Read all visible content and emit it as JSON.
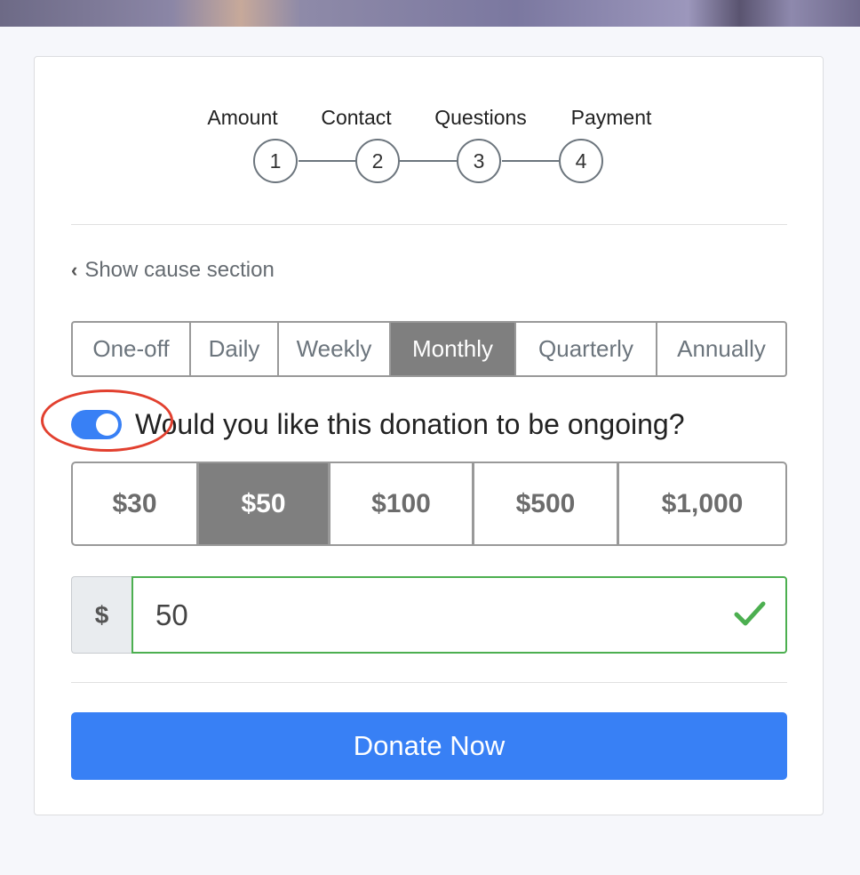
{
  "stepper": {
    "steps": [
      {
        "label": "Amount",
        "number": "1"
      },
      {
        "label": "Contact",
        "number": "2"
      },
      {
        "label": "Questions",
        "number": "3"
      },
      {
        "label": "Payment",
        "number": "4"
      }
    ]
  },
  "cause_link": {
    "label": "Show cause section"
  },
  "frequency": {
    "options": [
      "One-off",
      "Daily",
      "Weekly",
      "Monthly",
      "Quarterly",
      "Annually"
    ],
    "selected": "Monthly"
  },
  "ongoing": {
    "label": "Would you like this donation to be ongoing?",
    "enabled": true
  },
  "amounts": {
    "options": [
      "$30",
      "$50",
      "$100",
      "$500",
      "$1,000"
    ],
    "selected": "$50"
  },
  "custom_amount": {
    "currency_symbol": "$",
    "value": "50"
  },
  "donate_button": {
    "label": "Donate Now"
  },
  "colors": {
    "accent": "#3880f5",
    "selected": "#7f7f7f",
    "valid": "#4caf50",
    "highlight": "#e2402f"
  }
}
